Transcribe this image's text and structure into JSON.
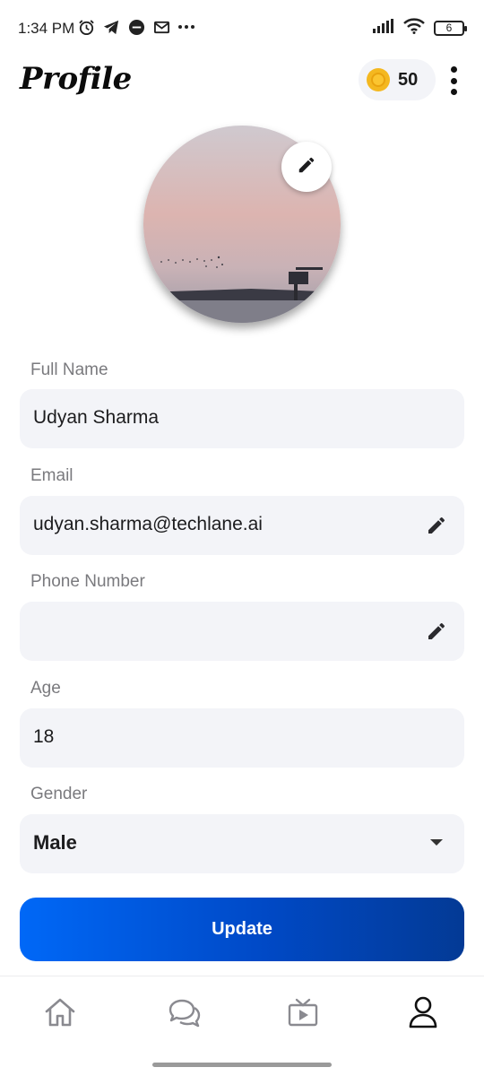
{
  "status_bar": {
    "time": "1:34 PM",
    "left_icons": [
      "alarm-icon",
      "telegram-icon",
      "uber-icon",
      "mail-icon",
      "more-notifications-icon"
    ],
    "battery": "6"
  },
  "header": {
    "title": "Profile",
    "coins": "50",
    "coin_icon": "coin-icon",
    "menu_icon": "more-vertical-icon"
  },
  "avatar": {
    "edit_icon": "pencil-icon"
  },
  "form": {
    "full_name": {
      "label": "Full Name",
      "value": "Udyan Sharma"
    },
    "email": {
      "label": "Email",
      "value": "udyan.sharma@techlane.ai"
    },
    "phone": {
      "label": "Phone Number",
      "value": ""
    },
    "age": {
      "label": "Age",
      "value": "18"
    },
    "gender": {
      "label": "Gender",
      "value": "Male"
    }
  },
  "update_label": "Update",
  "bottom_nav": {
    "items": [
      {
        "icon": "home-icon",
        "active": false
      },
      {
        "icon": "chat-icon",
        "active": false
      },
      {
        "icon": "tv-icon",
        "active": false
      },
      {
        "icon": "profile-icon",
        "active": true
      }
    ]
  },
  "colors": {
    "accent": "#0068f7",
    "accent_dark": "#033a95",
    "field_bg": "#f3f4f8",
    "coin": "#f4b820"
  }
}
